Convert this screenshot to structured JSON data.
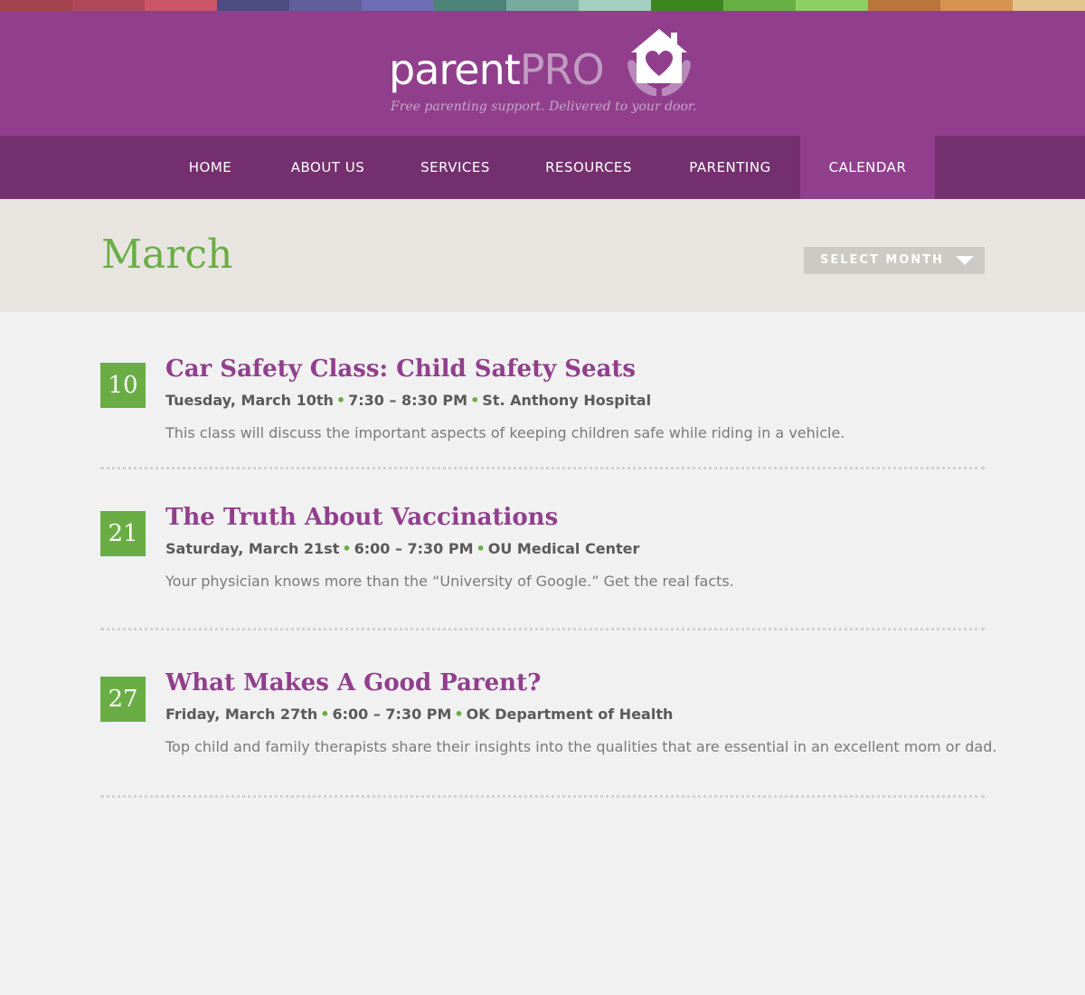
{
  "colors": {
    "strip": [
      "#a2424f",
      "#b14859",
      "#cc5567",
      "#4d4c81",
      "#605f9c",
      "#6f6eb5",
      "#4c8478",
      "#76ab9e",
      "#a3cfc0",
      "#3e8522",
      "#67b044",
      "#8ed163",
      "#b9763c",
      "#d4934f",
      "#e3c590"
    ],
    "header_bg": "#913f8d",
    "nav_bg": "#74306e",
    "accent_green": "#6aad45",
    "accent_purple": "#913f8d"
  },
  "logo": {
    "name_part1": "parent",
    "name_part2": "PRO",
    "tagline": "Free parenting support. Delivered to your door.",
    "mark_icon": "house-heart-hands-icon"
  },
  "nav": {
    "items": [
      {
        "label": "HOME",
        "active": false
      },
      {
        "label": "ABOUT US",
        "active": false
      },
      {
        "label": "SERVICES",
        "active": false
      },
      {
        "label": "RESOURCES",
        "active": false
      },
      {
        "label": "PARENTING",
        "active": false
      },
      {
        "label": "CALENDAR",
        "active": true
      }
    ]
  },
  "page": {
    "title": "March",
    "month_select_label": "SELECT MONTH"
  },
  "events": [
    {
      "day": "10",
      "title": "Car Safety Class: Child Safety Seats",
      "date": "Tuesday, March 10th",
      "time": "7:30 – 8:30 PM",
      "location": "St. Anthony Hospital",
      "description": "This class will discuss the important aspects of keeping children safe while riding in a vehicle."
    },
    {
      "day": "21",
      "title": "The Truth About Vaccinations",
      "date": "Saturday, March 21st",
      "time": "6:00 – 7:30 PM",
      "location": "OU Medical Center",
      "description": "Your physician knows more than the “University of Google.” Get the real facts."
    },
    {
      "day": "27",
      "title": "What Makes A Good Parent?",
      "date": "Friday, March 27th",
      "time": "6:00 – 7:30 PM",
      "location": "OK Department of Health",
      "description": "Top child and family therapists share their insights into the qualities that are essential in an excellent mom or dad."
    }
  ],
  "meta_separator": "•"
}
